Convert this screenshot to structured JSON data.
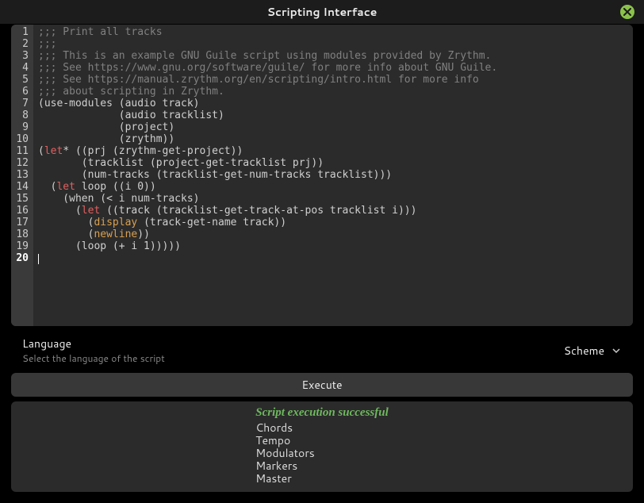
{
  "window": {
    "title": "Scripting Interface"
  },
  "editor": {
    "line_count": 20,
    "current_line": 20,
    "lines": [
      {
        "n": 1,
        "segs": [
          {
            "t": ";;; Print all tracks",
            "c": "cm"
          }
        ]
      },
      {
        "n": 2,
        "segs": [
          {
            "t": ";;;",
            "c": "cm"
          }
        ]
      },
      {
        "n": 3,
        "segs": [
          {
            "t": ";;; This is an example GNU Guile script using modules provided by Zrythm.",
            "c": "cm"
          }
        ]
      },
      {
        "n": 4,
        "segs": [
          {
            "t": ";;; See https://www.gnu.org/software/guile/ for more info about GNU Guile.",
            "c": "cm"
          }
        ]
      },
      {
        "n": 5,
        "segs": [
          {
            "t": ";;; See https://manual.zrythm.org/en/scripting/intro.html for more info",
            "c": "cm"
          }
        ]
      },
      {
        "n": 6,
        "segs": [
          {
            "t": ";;; about scripting in Zrythm.",
            "c": "cm"
          }
        ]
      },
      {
        "n": 7,
        "segs": [
          {
            "t": "(use-modules (audio track)",
            "c": ""
          }
        ]
      },
      {
        "n": 8,
        "segs": [
          {
            "t": "             (audio tracklist)",
            "c": ""
          }
        ]
      },
      {
        "n": 9,
        "segs": [
          {
            "t": "             (project)",
            "c": ""
          }
        ]
      },
      {
        "n": 10,
        "segs": [
          {
            "t": "             (zrythm))",
            "c": ""
          }
        ]
      },
      {
        "n": 11,
        "segs": [
          {
            "t": "(",
            "c": ""
          },
          {
            "t": "let",
            "c": "kw"
          },
          {
            "t": "* ((prj (zrythm-get-project))",
            "c": ""
          }
        ]
      },
      {
        "n": 12,
        "segs": [
          {
            "t": "       (tracklist (project-get-tracklist prj))",
            "c": ""
          }
        ]
      },
      {
        "n": 13,
        "segs": [
          {
            "t": "       (num-tracks (tracklist-get-num-tracks tracklist)))",
            "c": ""
          }
        ]
      },
      {
        "n": 14,
        "segs": [
          {
            "t": "  (",
            "c": ""
          },
          {
            "t": "let",
            "c": "kw"
          },
          {
            "t": " loop ((i 0))",
            "c": ""
          }
        ]
      },
      {
        "n": 15,
        "segs": [
          {
            "t": "    (when (< i num-tracks)",
            "c": ""
          }
        ]
      },
      {
        "n": 16,
        "segs": [
          {
            "t": "      (",
            "c": ""
          },
          {
            "t": "let",
            "c": "kw"
          },
          {
            "t": " ((track (tracklist-get-track-at-pos tracklist i)))",
            "c": ""
          }
        ]
      },
      {
        "n": 17,
        "segs": [
          {
            "t": "        (",
            "c": ""
          },
          {
            "t": "display",
            "c": "fn"
          },
          {
            "t": " (track-get-name track))",
            "c": ""
          }
        ]
      },
      {
        "n": 18,
        "segs": [
          {
            "t": "        (",
            "c": ""
          },
          {
            "t": "newline",
            "c": "fn"
          },
          {
            "t": "))",
            "c": ""
          }
        ]
      },
      {
        "n": 19,
        "segs": [
          {
            "t": "      (loop (+ i 1)))))",
            "c": ""
          }
        ]
      },
      {
        "n": 20,
        "segs": []
      }
    ]
  },
  "language": {
    "label": "Language",
    "subtitle": "Select the language of the script",
    "selected": "Scheme"
  },
  "execute": {
    "label": "Execute"
  },
  "output": {
    "status": "Script execution successful",
    "lines": [
      "Chords",
      "Tempo",
      "Modulators",
      "Markers",
      "Master"
    ]
  }
}
